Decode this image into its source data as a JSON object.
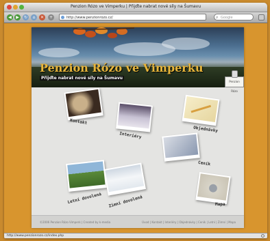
{
  "window": {
    "title": "Penzion Rózo ve Vimperku | Přijďte nabrat nové síly na Šumavu"
  },
  "toolbar": {
    "url": "http://www.penzionrozo.cz/",
    "search_placeholder": "Google",
    "buttons": [
      "back-icon",
      "forward-icon",
      "reload-icon",
      "home-icon",
      "stop-icon"
    ]
  },
  "site": {
    "title": "Penzion Rózo ve Vimperku",
    "subtitle": "Přijďte nabrat nové síly na Šumavu",
    "sign": "Penzion Rózo"
  },
  "menu": {
    "kontakt": "Kontakt",
    "interiery": "Interiéry",
    "objednavky": "Objednávky",
    "cenik": "Ceník",
    "letni": "Letní dovolená",
    "zimni": "Zimní dovolená",
    "mapa": "Mapa"
  },
  "footer": {
    "left": "©2006 Penzion Rózo Vimperk | Created by k-media",
    "right": "Úvod | Kontakt | Interiéry | Objednávky | Ceník | Letní | Zimní | Mapa"
  },
  "status": {
    "text": "http://www.penzionrozo.cz/index.php"
  },
  "colors": {
    "page_bg": "#d8952e",
    "title_gold": "#e8b53a"
  }
}
